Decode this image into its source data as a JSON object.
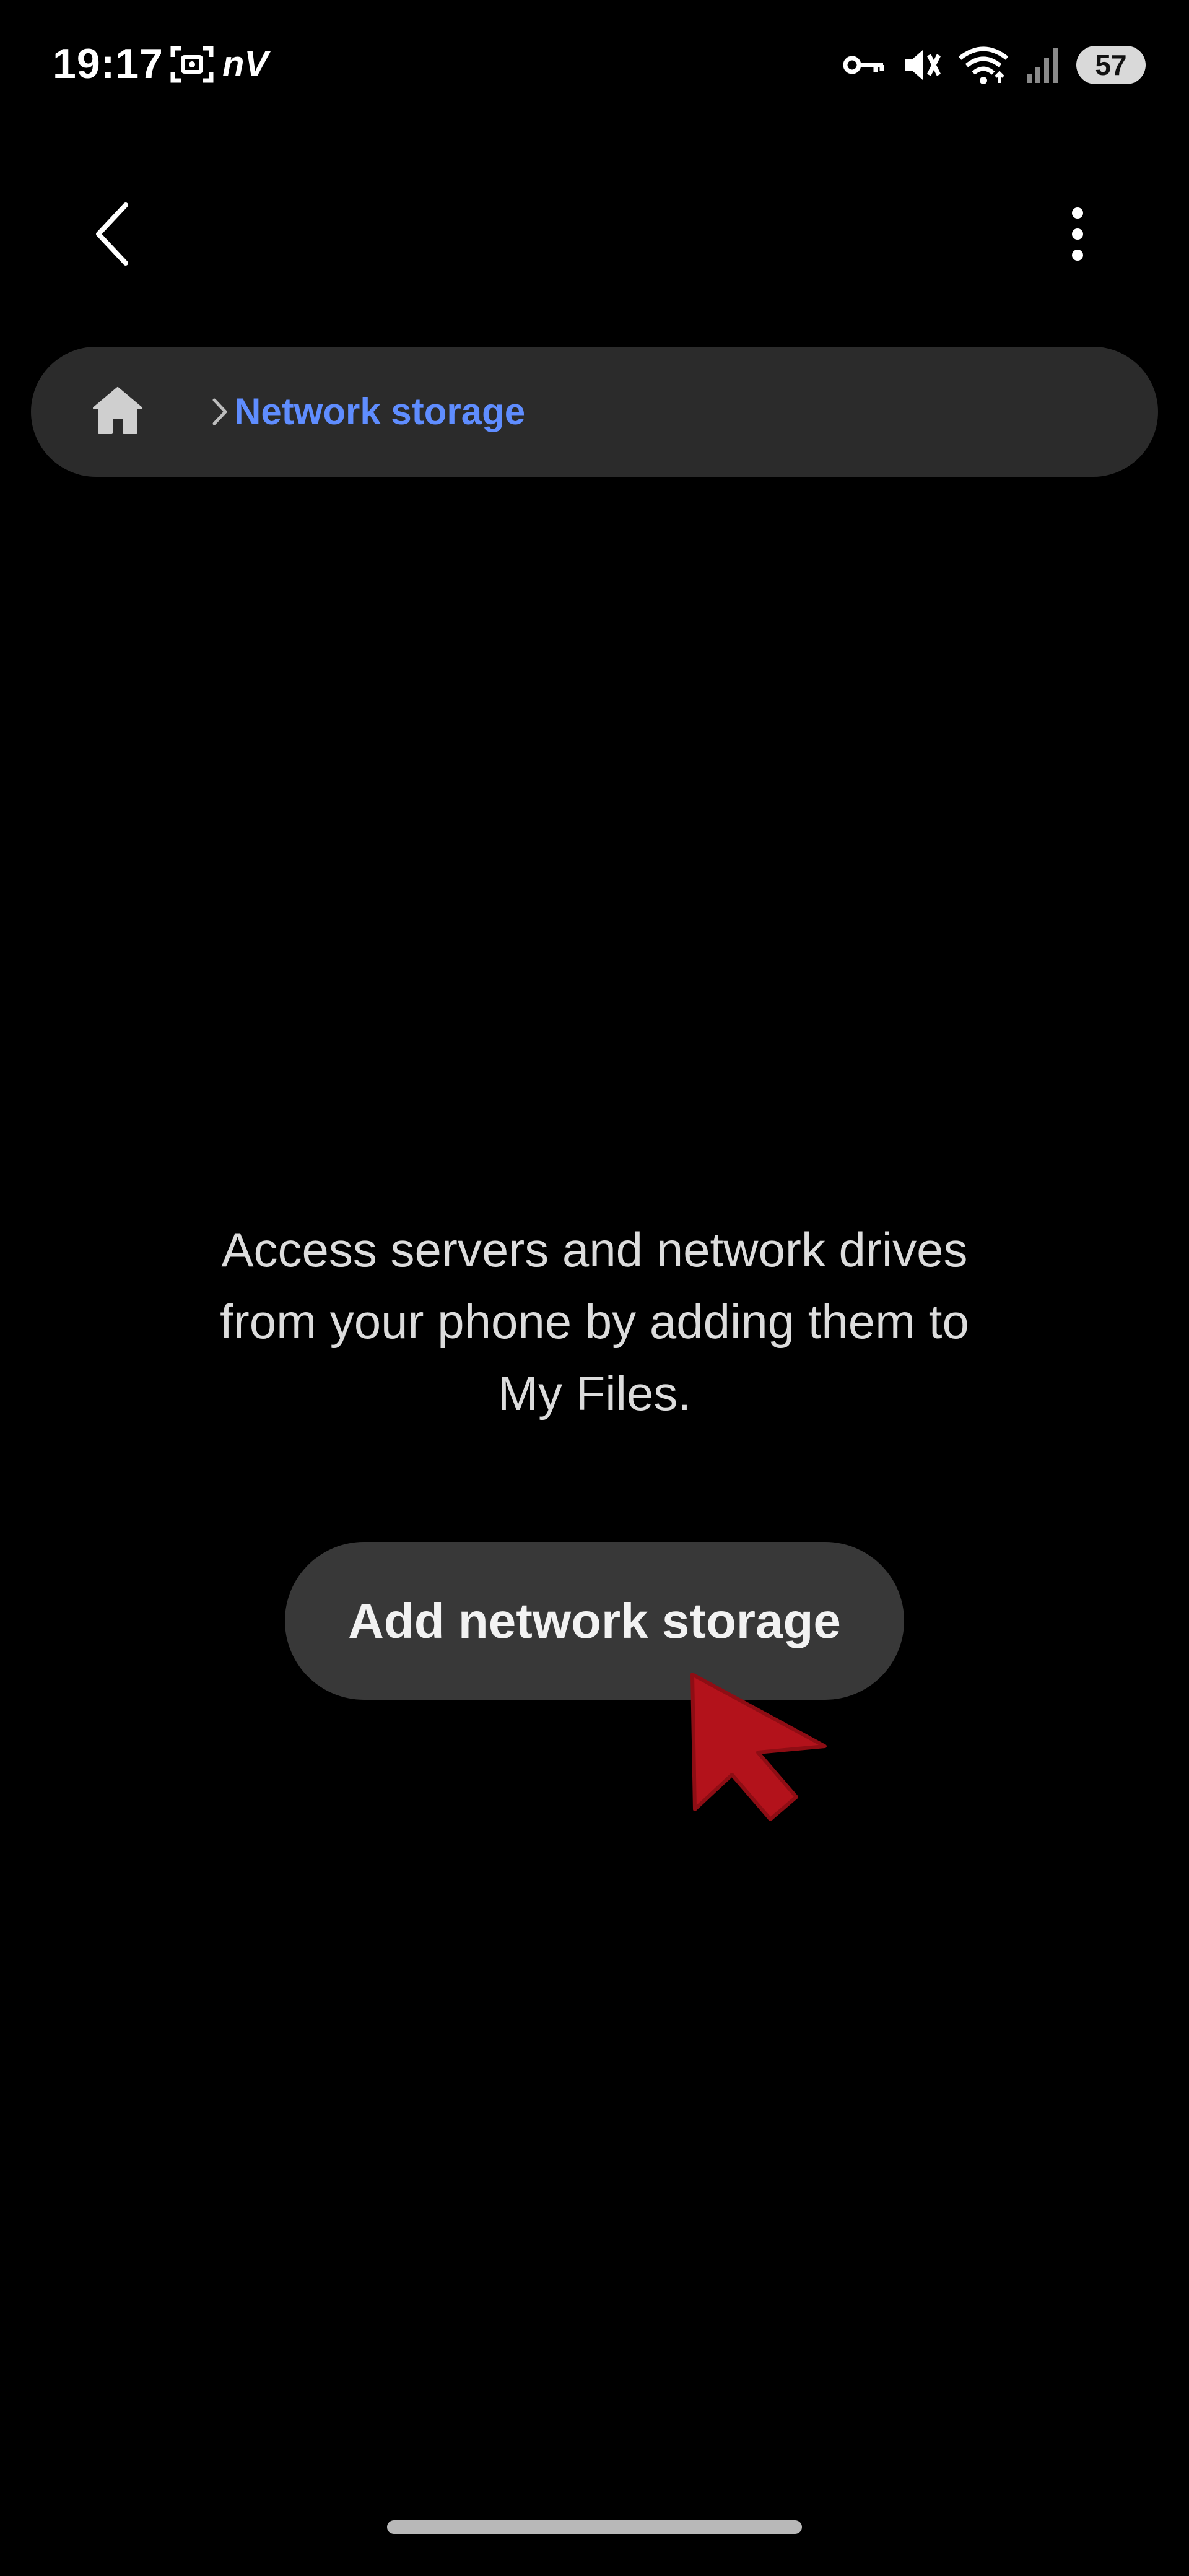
{
  "status_bar": {
    "time": "19:17",
    "carrier_text": "nV",
    "battery_level": "57",
    "icons": [
      "screenshot-icon",
      "vpn-key-icon",
      "mute-vibrate-icon",
      "wifi-icon",
      "signal-icon",
      "battery-icon"
    ]
  },
  "top_bar": {
    "back_icon": "chevron-left-icon",
    "more_icon": "more-vertical-icon"
  },
  "breadcrumb": {
    "home_icon": "home-icon",
    "separator_icon": "chevron-right-icon",
    "current": "Network storage"
  },
  "empty_state": {
    "message_line1": "Access servers and network drives",
    "message_line2": "from your phone by adding them to",
    "message_line3": "My Files.",
    "button_label": "Add network storage"
  },
  "colors": {
    "background": "#000000",
    "breadcrumb_bg": "#2b2b2b",
    "accent_link": "#5f8dff",
    "button_bg": "#383838",
    "cursor_red": "#b3121b"
  }
}
